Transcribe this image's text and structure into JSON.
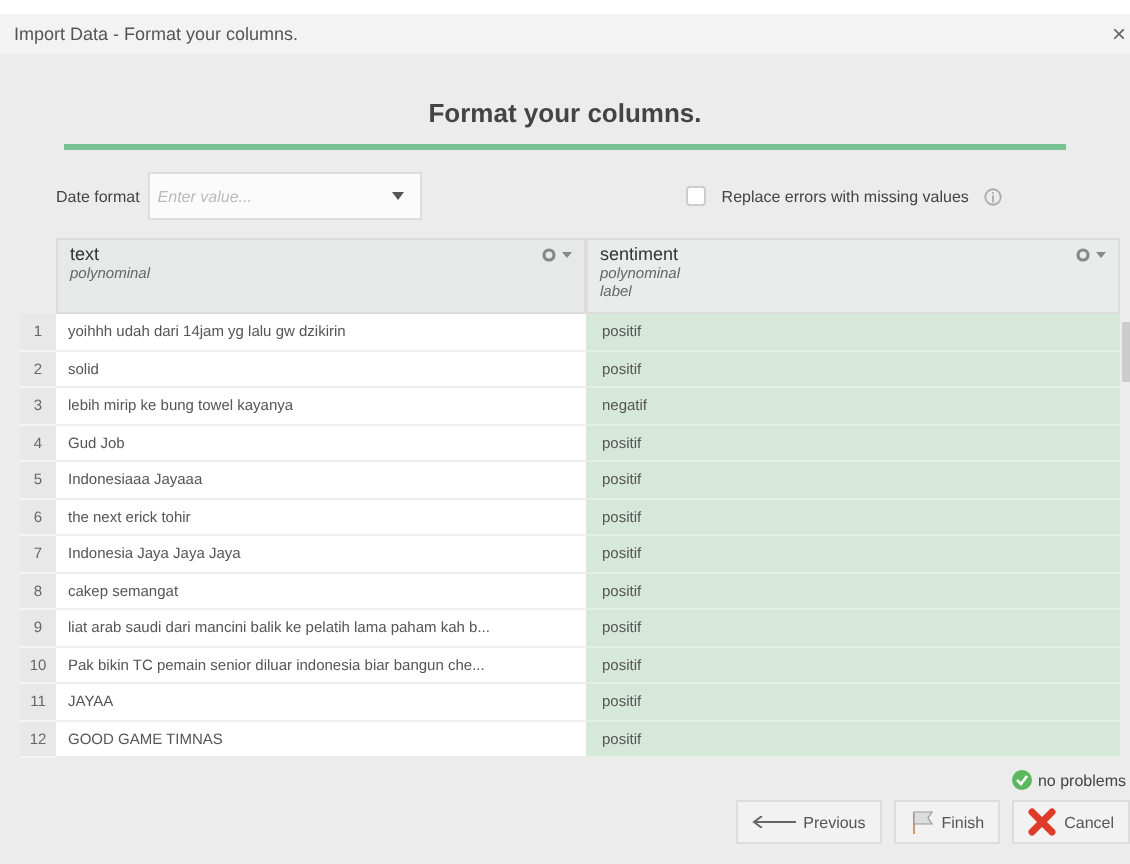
{
  "window": {
    "title": "Import Data - Format your columns.",
    "close": "×"
  },
  "heading": "Format your columns.",
  "date_format": {
    "label": "Date format",
    "placeholder": "Enter value..."
  },
  "replace_errors": {
    "label": "Replace errors with missing values",
    "checked": false
  },
  "table": {
    "columns": [
      {
        "name": "text",
        "types": [
          "polynominal"
        ],
        "role_column": false
      },
      {
        "name": "sentiment",
        "types": [
          "polynominal",
          "label"
        ],
        "role_column": true
      }
    ],
    "rows": [
      {
        "number": "1",
        "text": "yoihhh udah dari 14jam yg lalu gw dzikirin",
        "sentiment": "positif"
      },
      {
        "number": "2",
        "text": "solid",
        "sentiment": "positif"
      },
      {
        "number": "3",
        "text": "lebih mirip ke bung towel kayanya",
        "sentiment": "negatif"
      },
      {
        "number": "4",
        "text": "Gud Job",
        "sentiment": "positif"
      },
      {
        "number": "5",
        "text": "Indonesiaaa Jayaaa",
        "sentiment": "positif"
      },
      {
        "number": "6",
        "text": "the next erick tohir",
        "sentiment": "positif"
      },
      {
        "number": "7",
        "text": "Indonesia  Jaya Jaya Jaya",
        "sentiment": "positif"
      },
      {
        "number": "8",
        "text": "cakep semangat",
        "sentiment": "positif"
      },
      {
        "number": "9",
        "text": "liat arab saudi dari mancini balik ke pelatih lama paham kah b...",
        "sentiment": "positif"
      },
      {
        "number": "10",
        "text": "Pak bikin TC pemain senior diluar indonesia biar bangun che...",
        "sentiment": "positif"
      },
      {
        "number": "11",
        "text": "JAYAA",
        "sentiment": "positif"
      },
      {
        "number": "12",
        "text": "GOOD GAME TIMNAS",
        "sentiment": "positif"
      }
    ]
  },
  "status": "no problems",
  "buttons": [
    {
      "kind": "previous",
      "label": "Previous"
    },
    {
      "kind": "finish",
      "label": "Finish"
    },
    {
      "kind": "cancel",
      "label": "Cancel"
    }
  ]
}
